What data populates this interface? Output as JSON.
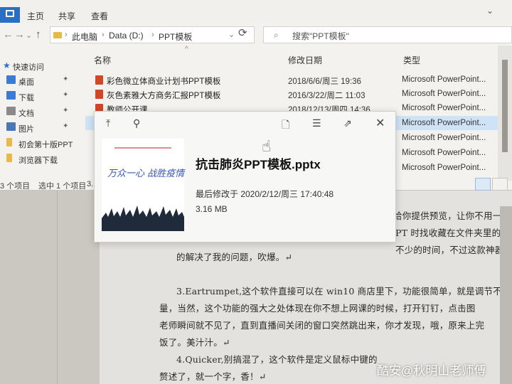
{
  "ribbon": {
    "tabs": [
      "主页",
      "共享",
      "查看"
    ]
  },
  "address_bar": {
    "breadcrumbs": [
      "此电脑",
      "Data (D:)",
      "PPT模板"
    ],
    "search_placeholder": "搜索\"PPT模板\""
  },
  "nav_pane": {
    "quick_access": "快速访问",
    "items": [
      {
        "label": "桌面",
        "icon": "desktop-icon",
        "color": "#3a7bd5"
      },
      {
        "label": "下载",
        "icon": "download-icon",
        "color": "#3a7bd5"
      },
      {
        "label": "文档",
        "icon": "document-icon",
        "color": "#8a8a8a"
      },
      {
        "label": "图片",
        "icon": "pictures-icon",
        "color": "#4a78b5"
      },
      {
        "label": "初会第十版PPT",
        "icon": "folder-icon",
        "color": "#e8b84a"
      },
      {
        "label": "浏览器下载",
        "icon": "folder-icon",
        "color": "#e8b84a"
      }
    ]
  },
  "file_list": {
    "columns": {
      "name": "名称",
      "date": "修改日期",
      "type": "类型"
    },
    "rows": [
      {
        "name": "彩色微立体商业计划书PPT模板",
        "date": "2018/6/6/周三 19:36",
        "type": "Microsoft PowerPoint...",
        "selected": false
      },
      {
        "name": "灰色素雅大方商务汇报PPT模板",
        "date": "2016/3/22/周二 11:03",
        "type": "Microsoft PowerPoint...",
        "selected": false
      },
      {
        "name": "教师公开课",
        "date": "2018/12/13/周四 14:36",
        "type": "Microsoft PowerPoint...",
        "selected": false
      },
      {
        "name": "",
        "date": "",
        "type": "Microsoft PowerPoint...",
        "selected": true
      },
      {
        "name": "",
        "date": "",
        "type": "Microsoft PowerPoint...",
        "selected": false
      },
      {
        "name": "",
        "date": "",
        "type": "Microsoft PowerPoint...",
        "selected": false
      },
      {
        "name": "",
        "date": "",
        "type": "Microsoft PowerPoint...",
        "selected": false
      }
    ]
  },
  "status_bar": {
    "count": "3 个项目",
    "selected": "选中 1 个项目",
    "size_fragment": "3."
  },
  "preview": {
    "filename": "抗击肺炎PPT模板.pptx",
    "modified": "最后修改于 2020/2/12/周三 17:40:48",
    "size": "3.16 MB",
    "thumb_slogan": "万众一心 战胜疫情"
  },
  "document": {
    "lines": [
      "给你提供预览，让你不用一",
      "PT 时找收藏在文件夹里的",
      "不少的时间，不过这款神器",
      "的解决了我的问题，吹爆。↵",
      "3.Eartrumpet,这个软件直接可以在 win10 商店里下，功能很简单，就是调节不同",
      "量，当然，这个功能的强大之处体现在你不想上网课的时候，打开钉钉，点击图",
      "老师瞬间就不见了，直到直播间关闭的窗口突然跳出来，你才发现，哦，原来上完",
      "饭了。美汁汁。↵",
      "4.Quicker,别搞混了，这个软件是定义鼠标中键的",
      "赘述了，就一个字，香！↵",
      "绍"
    ]
  },
  "watermark": "酷安@秋明山老师傅",
  "colors": {
    "accent": "#2a6fc4",
    "selection": "#cfe3f7",
    "ppt_icon": "#d24726"
  }
}
